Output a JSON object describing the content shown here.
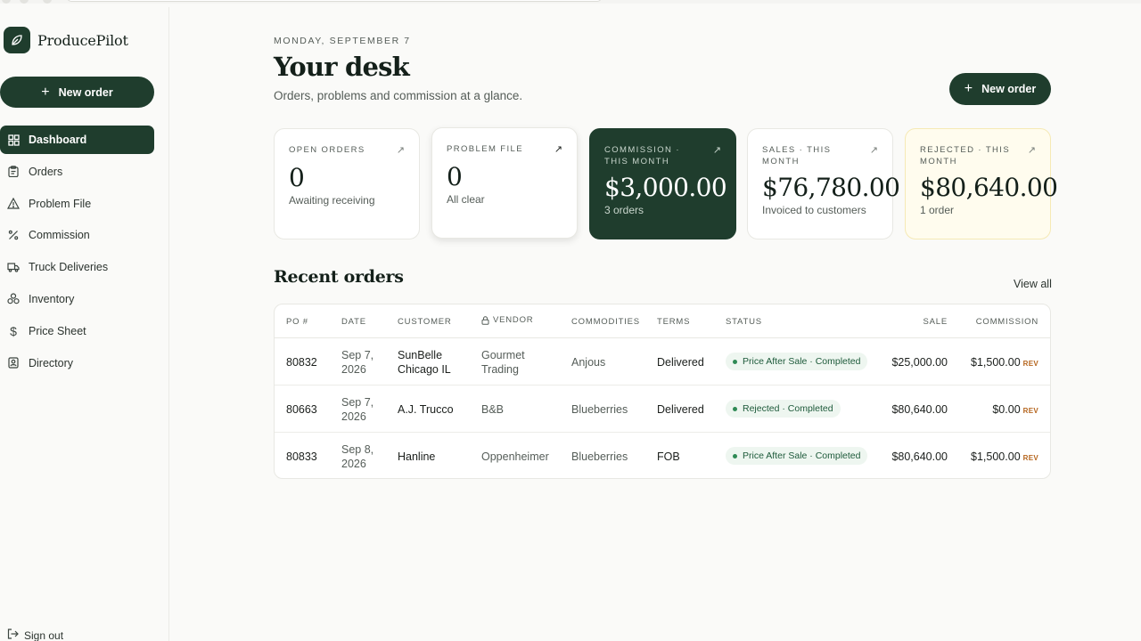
{
  "app": {
    "name": "ProducePilot",
    "primary_color": "#1f3d2d"
  },
  "sidebar": {
    "new_order_label": "New order",
    "items": [
      {
        "label": "Dashboard",
        "icon": "grid-icon",
        "active": true
      },
      {
        "label": "Orders",
        "icon": "clipboard-icon",
        "active": false
      },
      {
        "label": "Problem File",
        "icon": "warning-triangle-icon",
        "active": false
      },
      {
        "label": "Commission",
        "icon": "percent-icon",
        "active": false
      },
      {
        "label": "Truck Deliveries",
        "icon": "truck-icon",
        "active": false
      },
      {
        "label": "Inventory",
        "icon": "boxes-icon",
        "active": false
      },
      {
        "label": "Price Sheet",
        "icon": "dollar-icon",
        "active": false
      },
      {
        "label": "Directory",
        "icon": "contact-book-icon",
        "active": false
      }
    ],
    "sign_out_label": "Sign out"
  },
  "header": {
    "date": "MONDAY, SEPTEMBER 7",
    "title": "Your desk",
    "subtitle": "Orders, problems and commission at a glance.",
    "new_order_label": "New order"
  },
  "cards": [
    {
      "label": "OPEN ORDERS",
      "value": "0",
      "note": "Awaiting receiving"
    },
    {
      "label": "PROBLEM FILE",
      "value": "0",
      "note": "All clear"
    },
    {
      "label": "COMMISSION · THIS MONTH",
      "value": "$3,000.00",
      "note": "3 orders"
    },
    {
      "label": "SALES · THIS MONTH",
      "value": "$76,780.00",
      "note": "Invoiced to customers"
    },
    {
      "label": "REJECTED · THIS MONTH",
      "value": "$80,640.00",
      "note": "1 order"
    }
  ],
  "recent": {
    "title": "Recent orders",
    "view_all": "View all",
    "columns": {
      "po": "PO #",
      "date": "DATE",
      "customer": "CUSTOMER",
      "vendor": "VENDOR",
      "commodities": "COMMODITIES",
      "terms": "TERMS",
      "status": "STATUS",
      "sale": "SALE",
      "commission": "COMMISSION"
    },
    "rows": [
      {
        "po": "80832",
        "date": "Sep 7, 2026",
        "customer": "SunBelle Chicago IL",
        "vendor": "Gourmet Trading",
        "commodities": "Anjous",
        "terms": "Delivered",
        "status": "Price After Sale · Completed",
        "sale": "$25,000.00",
        "commission": "$1,500.00",
        "badge": "REV"
      },
      {
        "po": "80663",
        "date": "Sep 7, 2026",
        "customer": "A.J. Trucco",
        "vendor": "B&B",
        "commodities": "Blueberries",
        "terms": "Delivered",
        "status": "Rejected · Completed",
        "sale": "$80,640.00",
        "commission": "$0.00",
        "badge": "REV"
      },
      {
        "po": "80833",
        "date": "Sep 8, 2026",
        "customer": "Hanline",
        "vendor": "Oppenheimer",
        "commodities": "Blueberries",
        "terms": "FOB",
        "status": "Price After Sale · Completed",
        "sale": "$80,640.00",
        "commission": "$1,500.00",
        "badge": "REV"
      }
    ]
  }
}
